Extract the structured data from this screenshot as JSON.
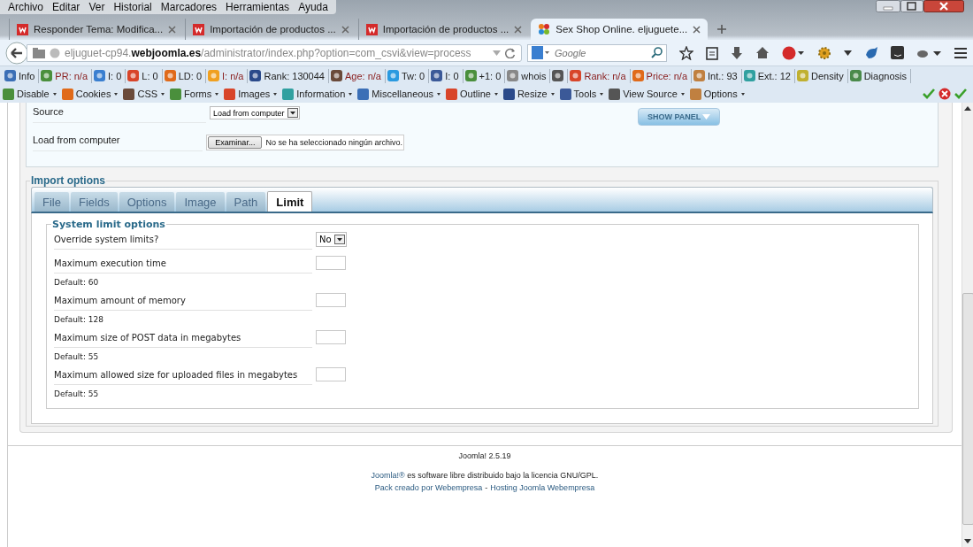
{
  "menu": [
    "Archivo",
    "Editar",
    "Ver",
    "Historial",
    "Marcadores",
    "Herramientas",
    "Ayuda"
  ],
  "browser_tabs": [
    {
      "title": "Responder Tema: Modifica...",
      "kind": "site",
      "selected": false
    },
    {
      "title": "Importación de productos ...",
      "kind": "site",
      "selected": false
    },
    {
      "title": "Importación de productos ...",
      "kind": "site",
      "selected": false
    },
    {
      "title": "Sex Shop Online. eljuguete...",
      "kind": "joomla",
      "selected": true
    }
  ],
  "address": {
    "url": "eljuguet-cp94.**webjoomla.es**/administrator/index.php?option=com_csvi&view=process"
  },
  "search": {
    "placeholder": "Google"
  },
  "seo_bar": [
    {
      "kind": "labeled",
      "text": "Info",
      "alert": false
    },
    {
      "kind": "labeled",
      "text": "PR: n/a",
      "alert": true
    },
    {
      "kind": "labeled",
      "text": "I: 0",
      "alert": false
    },
    {
      "kind": "labeled",
      "text": "L: 0",
      "alert": false
    },
    {
      "kind": "labeled",
      "text": "LD: 0",
      "alert": false
    },
    {
      "kind": "labeled",
      "text": "I: n/a",
      "alert": true
    },
    {
      "kind": "labeled",
      "text": "Rank: 130044",
      "alert": false
    },
    {
      "kind": "labeled",
      "text": "Age: n/a",
      "alert": true
    },
    {
      "kind": "labeled",
      "text": "Tw: 0",
      "alert": false
    },
    {
      "kind": "labeled",
      "text": "I: 0",
      "alert": false
    },
    {
      "kind": "labeled",
      "text": "+1: 0",
      "alert": false
    },
    {
      "kind": "labeled",
      "text": "whois",
      "alert": false
    },
    {
      "kind": "icon-only"
    },
    {
      "kind": "labeled",
      "text": "Rank: n/a",
      "alert": true
    },
    {
      "kind": "labeled",
      "text": "Price: n/a",
      "alert": true
    },
    {
      "kind": "labeled",
      "text": "Int.: 93",
      "alert": false
    },
    {
      "kind": "labeled",
      "text": "Ext.: 12",
      "alert": false
    },
    {
      "kind": "labeled",
      "text": "Density",
      "alert": false
    },
    {
      "kind": "labeled",
      "text": "Diagnosis",
      "alert": false
    }
  ],
  "webdev_bar": [
    "Disable",
    "Cookies",
    "CSS",
    "Forms",
    "Images",
    "Information",
    "Miscellaneous",
    "Outline",
    "Resize",
    "Tools",
    "View Source",
    "Options"
  ],
  "source_form": {
    "rows": [
      {
        "label": "Source",
        "kind": "select",
        "value": "Load from computer"
      },
      {
        "label": "Load from computer",
        "kind": "file",
        "button": "Examinar...",
        "value": "No se ha seleccionado ningún archivo."
      }
    ],
    "show_panel": "SHOW PANEL"
  },
  "import_options": {
    "legend": "Import options",
    "tabs": [
      {
        "label": "File",
        "selected": false
      },
      {
        "label": "Fields",
        "selected": false
      },
      {
        "label": "Options",
        "selected": false
      },
      {
        "label": "Image",
        "selected": false
      },
      {
        "label": "Path",
        "selected": false
      },
      {
        "label": "Limit",
        "selected": true
      }
    ],
    "fieldset": {
      "legend": "System limit options",
      "rows": [
        {
          "label": "Override system limits?",
          "kind": "select",
          "value": "No"
        },
        {
          "label": "Maximum execution time",
          "kind": "text",
          "default": "Default: 60"
        },
        {
          "label": "Maximum amount of memory",
          "kind": "text",
          "default": "Default: 128"
        },
        {
          "label": "Maximum size of POST data in megabytes",
          "kind": "text",
          "default": "Default: 55"
        },
        {
          "label": "Maximum allowed size for uploaded files in megabytes",
          "kind": "text",
          "default": "Default: 55"
        }
      ]
    }
  },
  "footer": {
    "version": "Joomla! 2.5.19",
    "license": {
      "link": "Joomla!®",
      "text": "es software libre distribuido bajo la licencia GNU/GPL."
    },
    "credits": {
      "links": [
        "Pack creado por Webempresa",
        "Hosting Joomla Webempresa"
      ],
      "separator": "-"
    }
  }
}
